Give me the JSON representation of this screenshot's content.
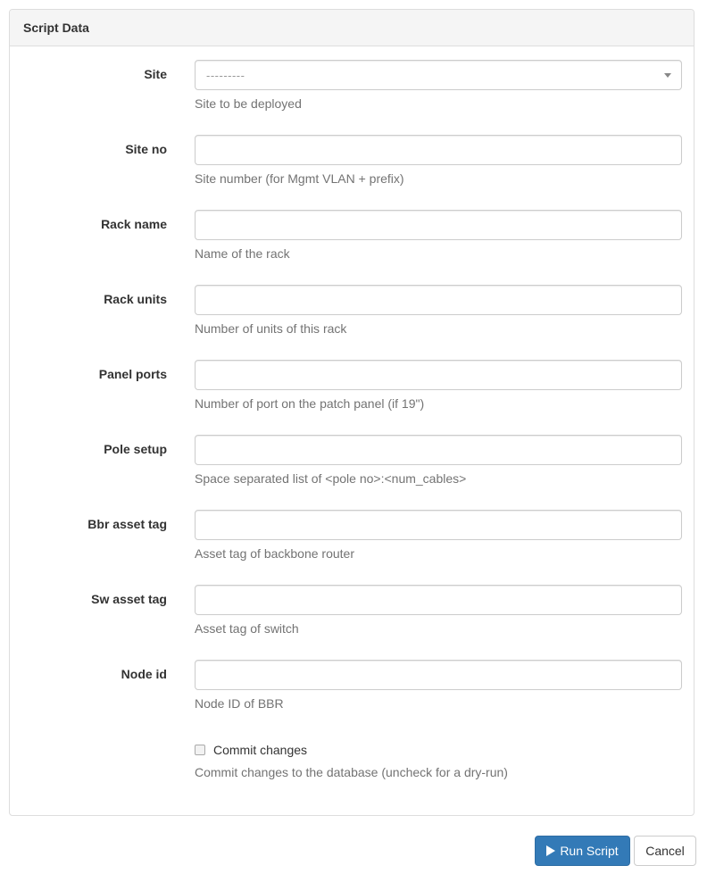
{
  "panel": {
    "title": "Script Data"
  },
  "fields": [
    {
      "label": "Site",
      "type": "select",
      "value": "---------",
      "help": "Site to be deployed"
    },
    {
      "label": "Site no",
      "type": "text",
      "value": "",
      "help": "Site number (for Mgmt VLAN + prefix)"
    },
    {
      "label": "Rack name",
      "type": "text",
      "value": "",
      "help": "Name of the rack"
    },
    {
      "label": "Rack units",
      "type": "text",
      "value": "",
      "help": "Number of units of this rack"
    },
    {
      "label": "Panel ports",
      "type": "text",
      "value": "",
      "help": "Number of port on the patch panel (if 19\")"
    },
    {
      "label": "Pole setup",
      "type": "text",
      "value": "",
      "help": "Space separated list of <pole no>:<num_cables>"
    },
    {
      "label": "Bbr asset tag",
      "type": "text",
      "value": "",
      "help": "Asset tag of backbone router"
    },
    {
      "label": "Sw asset tag",
      "type": "text",
      "value": "",
      "help": "Asset tag of switch"
    },
    {
      "label": "Node id",
      "type": "text",
      "value": "",
      "help": "Node ID of BBR"
    }
  ],
  "commit": {
    "label": "Commit changes",
    "checked": false,
    "help": "Commit changes to the database (uncheck for a dry-run)"
  },
  "buttons": {
    "run_label": "Run Script",
    "run_icon": "play-icon",
    "cancel_label": "Cancel"
  },
  "colors": {
    "primary": "#337ab7",
    "panel_heading_bg": "#f5f5f5",
    "border": "#dddddd",
    "help_text": "#737373"
  }
}
